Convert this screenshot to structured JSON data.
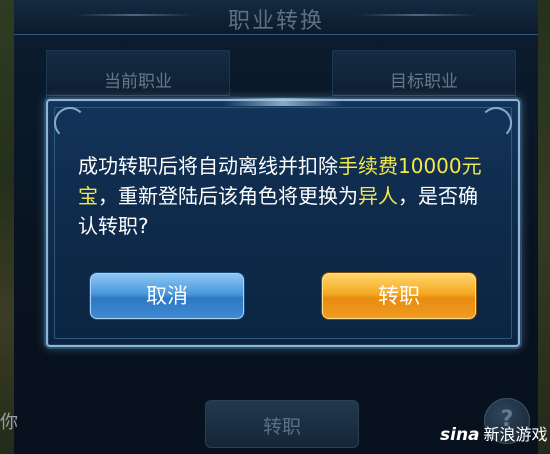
{
  "background": {
    "title": "职业转换",
    "current_job_label": "当前职业",
    "target_job_label": "目标职业",
    "transfer_button": "转职",
    "help_button": "?",
    "left_partial_char": "你"
  },
  "dialog": {
    "message_part1": "成功转职后将自动离线并扣除",
    "message_fee": "手续费10000元宝",
    "message_part2": "，重新登陆后该角色将更换为",
    "message_role": "异人",
    "message_part3": "，是否确认转职?",
    "cancel_label": "取消",
    "confirm_label": "转职"
  },
  "watermark": {
    "logo": "sina",
    "text": "新浪游戏"
  },
  "colors": {
    "highlight": "#f3e84c",
    "cancel_button": "#4b98dc",
    "confirm_button": "#f4a922"
  }
}
